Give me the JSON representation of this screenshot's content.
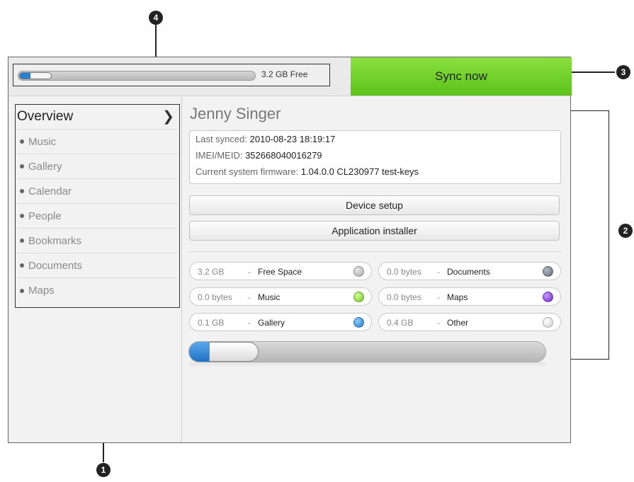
{
  "topbar": {
    "storage_free": "3.2  GB Free",
    "storage_used_fraction": 0.14,
    "sync_label": "Sync now"
  },
  "sidebar": {
    "items": [
      {
        "label": "Overview"
      },
      {
        "label": "Music"
      },
      {
        "label": "Gallery"
      },
      {
        "label": "Calendar"
      },
      {
        "label": "People"
      },
      {
        "label": "Bookmarks"
      },
      {
        "label": "Documents"
      },
      {
        "label": "Maps"
      }
    ]
  },
  "main": {
    "user_name": "Jenny Singer",
    "info": {
      "last_synced_label": "Last synced:",
      "last_synced_value": "2010-08-23 18:19:17",
      "imei_label": "IMEI/MEID:",
      "imei_value": "352668040016279",
      "firmware_label": "Current system firmware:",
      "firmware_value": "1.04.0.0 CL230977 test-keys"
    },
    "buttons": {
      "device_setup": "Device setup",
      "app_installer": "Application installer"
    },
    "storage_items": [
      {
        "value": "3.2  GB",
        "dash": "-",
        "name": "Free Space",
        "color": "#a8a8a8"
      },
      {
        "value": "0.0  bytes",
        "dash": "-",
        "name": "Documents",
        "color": "#6c7585"
      },
      {
        "value": "0.0  bytes",
        "dash": "-",
        "name": "Music",
        "color": "#7ed321"
      },
      {
        "value": "0.0  bytes",
        "dash": "-",
        "name": "Maps",
        "color": "#7a2fd0"
      },
      {
        "value": "0.1  GB",
        "dash": "-",
        "name": "Gallery",
        "color": "#2a82d6"
      },
      {
        "value": "0.4  GB",
        "dash": "-",
        "name": "Other",
        "color": "#e6e6e6"
      }
    ]
  },
  "callouts": {
    "c1": "1",
    "c2": "2",
    "c3": "3",
    "c4": "4"
  }
}
